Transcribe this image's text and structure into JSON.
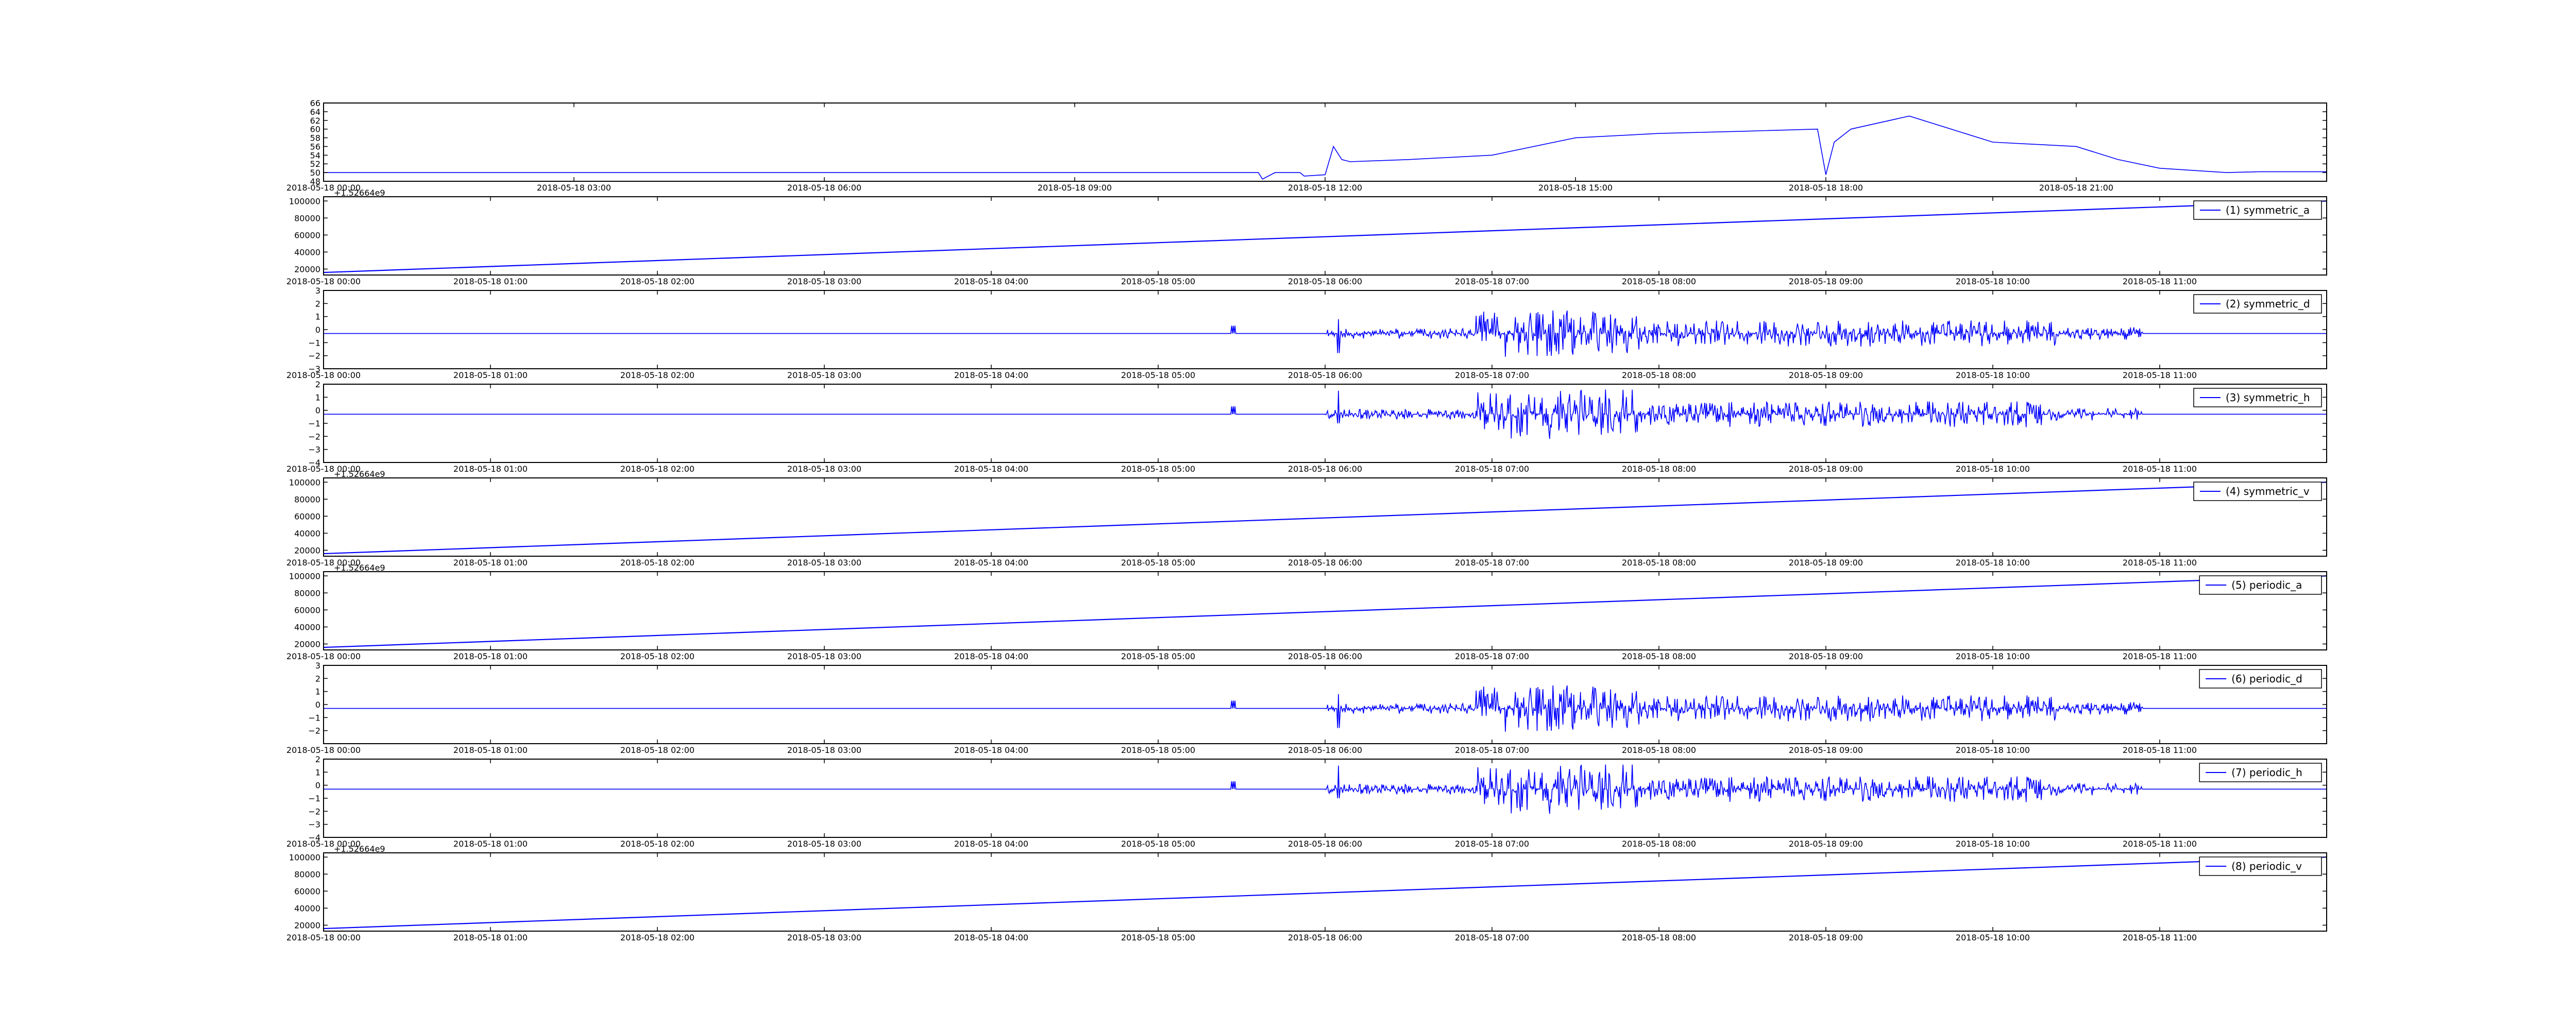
{
  "colors": {
    "line": "#0000ff",
    "axes": "#000000",
    "background": "#ffffff"
  },
  "chart_data": [
    {
      "type": "line",
      "legend_label": "",
      "legend_position": "",
      "offset_label": "",
      "x_ticks": [
        "2018-05-18 00:00",
        "2018-05-18 03:00",
        "2018-05-18 06:00",
        "2018-05-18 09:00",
        "2018-05-18 12:00",
        "2018-05-18 15:00",
        "2018-05-18 18:00",
        "2018-05-18 21:00"
      ],
      "x_tick_hours": [
        0,
        3,
        6,
        9,
        12,
        15,
        18,
        21
      ],
      "xlim_hours": [
        0,
        24
      ],
      "y_ticks": [
        "48",
        "50",
        "52",
        "54",
        "56",
        "58",
        "60",
        "62",
        "64",
        "66"
      ],
      "y_tick_values": [
        48,
        50,
        52,
        54,
        56,
        58,
        60,
        62,
        64,
        66
      ],
      "ylim": [
        48,
        66
      ],
      "signal": "temperature-like",
      "series": [
        {
          "x_hours": [
            0,
            11.2,
            11.25,
            11.4,
            11.7,
            11.75,
            12.0,
            12.1,
            12.2,
            12.3,
            13,
            14,
            15,
            16,
            17,
            17.9,
            18.0,
            18.1,
            18.3,
            19,
            20,
            21,
            21.5,
            22,
            22.8,
            23.2,
            24
          ],
          "values": [
            50,
            50,
            48.5,
            50,
            50,
            49.2,
            49.5,
            56,
            53,
            52.5,
            53,
            54,
            58,
            59,
            59.5,
            60,
            49.5,
            57,
            60,
            63,
            57,
            56,
            53,
            51,
            50,
            50.2,
            50.2
          ]
        }
      ]
    },
    {
      "type": "line",
      "legend_label": "(1) symmetric_a",
      "legend_position": "top-right",
      "offset_label": "+1.52664e9",
      "x_ticks": [
        "2018-05-18 00:00",
        "2018-05-18 01:00",
        "2018-05-18 02:00",
        "2018-05-18 03:00",
        "2018-05-18 04:00",
        "2018-05-18 05:00",
        "2018-05-18 06:00",
        "2018-05-18 07:00",
        "2018-05-18 08:00",
        "2018-05-18 09:00",
        "2018-05-18 10:00",
        "2018-05-18 11:00"
      ],
      "x_tick_hours": [
        0,
        1,
        2,
        3,
        4,
        5,
        6,
        7,
        8,
        9,
        10,
        11
      ],
      "xlim_hours": [
        0,
        12
      ],
      "y_ticks": [
        "20000",
        "40000",
        "60000",
        "80000",
        "100000"
      ],
      "y_tick_values": [
        20000,
        40000,
        60000,
        80000,
        100000
      ],
      "ylim": [
        13000,
        105000
      ],
      "signal": "linear",
      "series": [
        {
          "x_hours": [
            0,
            12
          ],
          "values": [
            16000,
            100000
          ]
        }
      ]
    },
    {
      "type": "line",
      "legend_label": "(2) symmetric_d",
      "legend_position": "top-right",
      "offset_label": "",
      "x_ticks": [
        "2018-05-18 00:00",
        "2018-05-18 01:00",
        "2018-05-18 02:00",
        "2018-05-18 03:00",
        "2018-05-18 04:00",
        "2018-05-18 05:00",
        "2018-05-18 06:00",
        "2018-05-18 07:00",
        "2018-05-18 08:00",
        "2018-05-18 09:00",
        "2018-05-18 10:00",
        "2018-05-18 11:00"
      ],
      "x_tick_hours": [
        0,
        1,
        2,
        3,
        4,
        5,
        6,
        7,
        8,
        9,
        10,
        11
      ],
      "xlim_hours": [
        0,
        12
      ],
      "y_ticks": [
        "−3",
        "−2",
        "−1",
        "0",
        "1",
        "2",
        "3"
      ],
      "y_tick_values": [
        -3,
        -2,
        -1,
        0,
        1,
        2,
        3
      ],
      "ylim": [
        -3,
        3
      ],
      "signal": "noise",
      "noise": {
        "baseline": -0.3,
        "spike_hour": 6.08,
        "spike_up": 0.8,
        "spike_down": -1.8,
        "active_start": 6.0,
        "active_end": 10.9,
        "peak_hour": 7.5,
        "amp_low": 0.4,
        "amp_mid": 1.0,
        "amp_high": 1.8,
        "seed": 11
      }
    },
    {
      "type": "line",
      "legend_label": "(3) symmetric_h",
      "legend_position": "top-right",
      "offset_label": "",
      "x_ticks": [
        "2018-05-18 00:00",
        "2018-05-18 01:00",
        "2018-05-18 02:00",
        "2018-05-18 03:00",
        "2018-05-18 04:00",
        "2018-05-18 05:00",
        "2018-05-18 06:00",
        "2018-05-18 07:00",
        "2018-05-18 08:00",
        "2018-05-18 09:00",
        "2018-05-18 10:00",
        "2018-05-18 11:00"
      ],
      "x_tick_hours": [
        0,
        1,
        2,
        3,
        4,
        5,
        6,
        7,
        8,
        9,
        10,
        11
      ],
      "xlim_hours": [
        0,
        12
      ],
      "y_ticks": [
        "−4",
        "−3",
        "−2",
        "−1",
        "0",
        "1",
        "2"
      ],
      "y_tick_values": [
        -4,
        -3,
        -2,
        -1,
        0,
        1,
        2
      ],
      "ylim": [
        -4,
        2
      ],
      "signal": "noise",
      "noise": {
        "baseline": -0.3,
        "spike_hour": 6.08,
        "spike_up": 1.5,
        "spike_down": -1.0,
        "active_start": 6.0,
        "active_end": 10.9,
        "peak_hour": 7.5,
        "amp_low": 0.4,
        "amp_mid": 1.0,
        "amp_high": 1.9,
        "seed": 23
      }
    },
    {
      "type": "line",
      "legend_label": "(4) symmetric_v",
      "legend_position": "top-right",
      "offset_label": "+1.52664e9",
      "x_ticks": [
        "2018-05-18 00:00",
        "2018-05-18 01:00",
        "2018-05-18 02:00",
        "2018-05-18 03:00",
        "2018-05-18 04:00",
        "2018-05-18 05:00",
        "2018-05-18 06:00",
        "2018-05-18 07:00",
        "2018-05-18 08:00",
        "2018-05-18 09:00",
        "2018-05-18 10:00",
        "2018-05-18 11:00"
      ],
      "x_tick_hours": [
        0,
        1,
        2,
        3,
        4,
        5,
        6,
        7,
        8,
        9,
        10,
        11
      ],
      "xlim_hours": [
        0,
        12
      ],
      "y_ticks": [
        "20000",
        "40000",
        "60000",
        "80000",
        "100000"
      ],
      "y_tick_values": [
        20000,
        40000,
        60000,
        80000,
        100000
      ],
      "ylim": [
        13000,
        105000
      ],
      "signal": "linear",
      "series": [
        {
          "x_hours": [
            0,
            12
          ],
          "values": [
            16000,
            100000
          ]
        }
      ]
    },
    {
      "type": "line",
      "legend_label": "(5) periodic_a",
      "legend_position": "top-right",
      "offset_label": "+1.52664e9",
      "x_ticks": [
        "2018-05-18 00:00",
        "2018-05-18 01:00",
        "2018-05-18 02:00",
        "2018-05-18 03:00",
        "2018-05-18 04:00",
        "2018-05-18 05:00",
        "2018-05-18 06:00",
        "2018-05-18 07:00",
        "2018-05-18 08:00",
        "2018-05-18 09:00",
        "2018-05-18 10:00",
        "2018-05-18 11:00"
      ],
      "x_tick_hours": [
        0,
        1,
        2,
        3,
        4,
        5,
        6,
        7,
        8,
        9,
        10,
        11
      ],
      "xlim_hours": [
        0,
        12
      ],
      "y_ticks": [
        "20000",
        "40000",
        "60000",
        "80000",
        "100000"
      ],
      "y_tick_values": [
        20000,
        40000,
        60000,
        80000,
        100000
      ],
      "ylim": [
        13000,
        105000
      ],
      "signal": "linear",
      "series": [
        {
          "x_hours": [
            0,
            12
          ],
          "values": [
            16000,
            100000
          ]
        }
      ]
    },
    {
      "type": "line",
      "legend_label": "(6) periodic_d",
      "legend_position": "top-right",
      "offset_label": "",
      "x_ticks": [
        "2018-05-18 00:00",
        "2018-05-18 01:00",
        "2018-05-18 02:00",
        "2018-05-18 03:00",
        "2018-05-18 04:00",
        "2018-05-18 05:00",
        "2018-05-18 06:00",
        "2018-05-18 07:00",
        "2018-05-18 08:00",
        "2018-05-18 09:00",
        "2018-05-18 10:00",
        "2018-05-18 11:00"
      ],
      "x_tick_hours": [
        0,
        1,
        2,
        3,
        4,
        5,
        6,
        7,
        8,
        9,
        10,
        11
      ],
      "xlim_hours": [
        0,
        12
      ],
      "y_ticks": [
        "−2",
        "−1",
        "0",
        "1",
        "2",
        "3"
      ],
      "y_tick_values": [
        -2,
        -1,
        0,
        1,
        2,
        3
      ],
      "ylim": [
        -3,
        3
      ],
      "signal": "noise",
      "noise": {
        "baseline": -0.3,
        "spike_hour": 6.08,
        "spike_up": 0.8,
        "spike_down": -1.8,
        "active_start": 6.0,
        "active_end": 10.9,
        "peak_hour": 7.5,
        "amp_low": 0.4,
        "amp_mid": 1.0,
        "amp_high": 1.8,
        "seed": 11
      }
    },
    {
      "type": "line",
      "legend_label": "(7) periodic_h",
      "legend_position": "top-right",
      "offset_label": "",
      "x_ticks": [
        "2018-05-18 00:00",
        "2018-05-18 01:00",
        "2018-05-18 02:00",
        "2018-05-18 03:00",
        "2018-05-18 04:00",
        "2018-05-18 05:00",
        "2018-05-18 06:00",
        "2018-05-18 07:00",
        "2018-05-18 08:00",
        "2018-05-18 09:00",
        "2018-05-18 10:00",
        "2018-05-18 11:00"
      ],
      "x_tick_hours": [
        0,
        1,
        2,
        3,
        4,
        5,
        6,
        7,
        8,
        9,
        10,
        11
      ],
      "xlim_hours": [
        0,
        12
      ],
      "y_ticks": [
        "−4",
        "−3",
        "−2",
        "−1",
        "0",
        "1",
        "2"
      ],
      "y_tick_values": [
        -4,
        -3,
        -2,
        -1,
        0,
        1,
        2
      ],
      "ylim": [
        -4,
        2
      ],
      "signal": "noise",
      "noise": {
        "baseline": -0.3,
        "spike_hour": 6.08,
        "spike_up": 1.5,
        "spike_down": -1.0,
        "active_start": 6.0,
        "active_end": 10.9,
        "peak_hour": 7.5,
        "amp_low": 0.4,
        "amp_mid": 1.0,
        "amp_high": 1.9,
        "seed": 23
      }
    },
    {
      "type": "line",
      "legend_label": "(8) periodic_v",
      "legend_position": "top-right",
      "offset_label": "+1.52664e9",
      "x_ticks": [
        "2018-05-18 00:00",
        "2018-05-18 01:00",
        "2018-05-18 02:00",
        "2018-05-18 03:00",
        "2018-05-18 04:00",
        "2018-05-18 05:00",
        "2018-05-18 06:00",
        "2018-05-18 07:00",
        "2018-05-18 08:00",
        "2018-05-18 09:00",
        "2018-05-18 10:00",
        "2018-05-18 11:00"
      ],
      "x_tick_hours": [
        0,
        1,
        2,
        3,
        4,
        5,
        6,
        7,
        8,
        9,
        10,
        11
      ],
      "xlim_hours": [
        0,
        12
      ],
      "y_ticks": [
        "20000",
        "40000",
        "60000",
        "80000",
        "100000"
      ],
      "y_tick_values": [
        20000,
        40000,
        60000,
        80000,
        100000
      ],
      "ylim": [
        13000,
        105000
      ],
      "signal": "linear",
      "series": [
        {
          "x_hours": [
            0,
            12
          ],
          "values": [
            16000,
            100000
          ]
        }
      ]
    }
  ]
}
